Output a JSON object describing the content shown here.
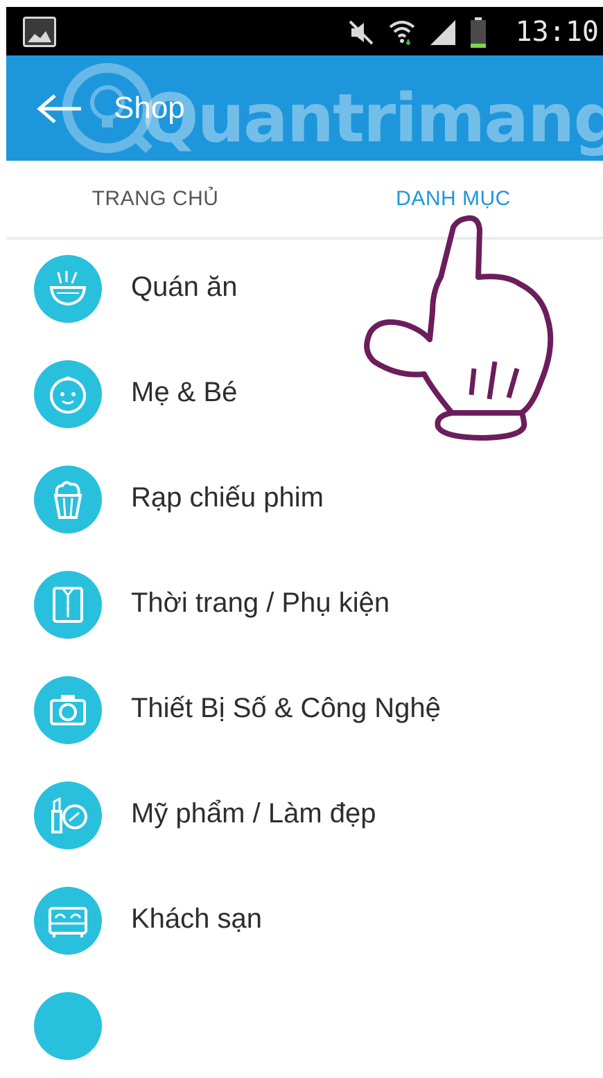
{
  "status_bar": {
    "time": "13:10",
    "icons": [
      "image-thumbnail-icon",
      "mute-icon",
      "wifi-icon",
      "signal-icon",
      "battery-icon"
    ]
  },
  "app_bar": {
    "title": "Shop",
    "back_icon": "back-arrow-icon",
    "watermark": "Quantrimang",
    "background_color": "#1e96dc"
  },
  "tabs": [
    {
      "label": "TRANG CHỦ",
      "active": false
    },
    {
      "label": "DANH MỤC",
      "active": true
    }
  ],
  "accent_color": "#1e96dc",
  "icon_circle_color": "#28c0dd",
  "categories": [
    {
      "label": "Quán ăn",
      "icon": "food-bowl-icon"
    },
    {
      "label": "Mẹ & Bé",
      "icon": "baby-face-icon"
    },
    {
      "label": "Rạp chiếu phim",
      "icon": "popcorn-icon"
    },
    {
      "label": "Thời trang / Phụ kiện",
      "icon": "clothing-icon"
    },
    {
      "label": "Thiết Bị Số & Công Nghệ",
      "icon": "camera-icon"
    },
    {
      "label": "Mỹ phẩm / Làm đẹp",
      "icon": "cosmetics-icon"
    },
    {
      "label": "Khách sạn",
      "icon": "hotel-bed-icon"
    },
    {
      "label": "",
      "icon": "category-icon"
    }
  ],
  "overlay": {
    "type": "pointing-hand-icon",
    "stroke_color": "#6b1d5c"
  }
}
